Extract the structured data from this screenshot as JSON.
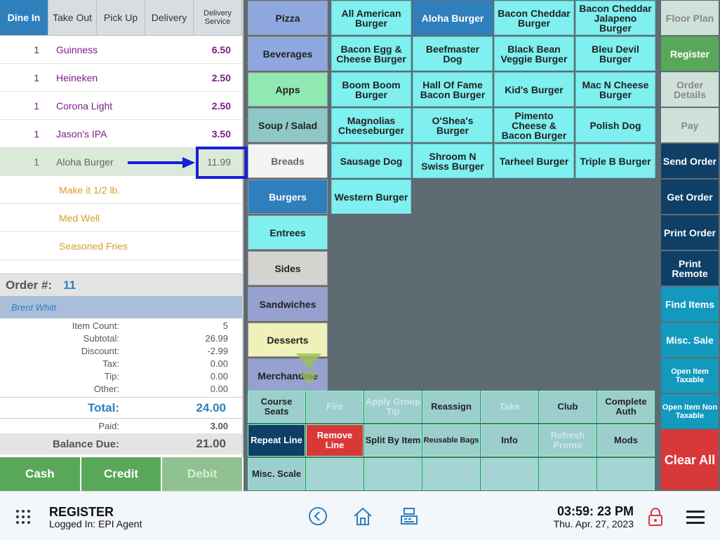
{
  "order_tabs": [
    {
      "label": "Dine In",
      "active": true
    },
    {
      "label": "Take Out"
    },
    {
      "label": "Pick Up"
    },
    {
      "label": "Delivery"
    },
    {
      "label": "Delivery Service"
    }
  ],
  "items": [
    {
      "qty": "1",
      "name": "Guinness",
      "price": "6.50"
    },
    {
      "qty": "1",
      "name": "Heineken",
      "price": "2.50"
    },
    {
      "qty": "1",
      "name": "Corona Light",
      "price": "2.50"
    },
    {
      "qty": "1",
      "name": "Jason's IPA",
      "price": "3.50"
    },
    {
      "qty": "1",
      "name": "Aloha Burger",
      "price": "11.99",
      "selected": true
    },
    {
      "name": "Make it 1/2 lb.",
      "modifier": true
    },
    {
      "name": "Med Well",
      "modifier": true
    },
    {
      "name": "Seasoned Fries",
      "modifier": true
    }
  ],
  "order": {
    "label": "Order #:",
    "number": "11",
    "customer": "Brent Whitt"
  },
  "totals": [
    {
      "k": "Item Count:",
      "v": "5"
    },
    {
      "k": "Subtotal:",
      "v": "26.99"
    },
    {
      "k": "Discount:",
      "v": "-2.99"
    },
    {
      "k": "Tax:",
      "v": "0.00"
    },
    {
      "k": "Tip:",
      "v": "0.00"
    },
    {
      "k": "Other:",
      "v": "0.00"
    }
  ],
  "total": {
    "k": "Total:",
    "v": "24.00"
  },
  "paid": {
    "k": "Paid:",
    "v": "3.00"
  },
  "balance": {
    "k": "Balance Due:",
    "v": "21.00"
  },
  "pay_buttons": [
    "Cash",
    "Credit",
    "Debit"
  ],
  "categories": [
    "Pizza",
    "Beverages",
    "Apps",
    "Soup / Salad",
    "Breads",
    "Burgers",
    "Entrees",
    "Sides",
    "Sandwiches",
    "Desserts",
    "Merchandise"
  ],
  "menu_items": [
    "All American Burger",
    "Aloha Burger",
    "Bacon Cheddar Burger",
    "Bacon Cheddar Jalapeno Burger",
    "Bacon Egg & Cheese Burger",
    "Beefmaster Dog",
    "Black Bean Veggie Burger",
    "Bleu Devil Burger",
    "Boom Boom Burger",
    "Hall Of Fame Bacon Burger",
    "Kid's Burger",
    "Mac N Cheese Burger",
    "Magnolias Cheeseburger",
    "O'Shea's Burger",
    "Pimento Cheese & Bacon Burger",
    "Polish Dog",
    "Sausage Dog",
    "Shroom N Swiss Burger",
    "Tarheel Burger",
    "Triple B Burger",
    "Western Burger"
  ],
  "actions": [
    "Course Seats",
    "Fire",
    "Apply Group Tip",
    "Reassign",
    "Take",
    "Club",
    "Complete Auth",
    "Repeat Line",
    "Remove Line",
    "Split By Item",
    "Reusable Bags",
    "Info",
    "Refresh Promo",
    "Mods",
    "Misc. Scale"
  ],
  "right_buttons": [
    "Floor Plan",
    "Register",
    "Order Details",
    "Pay",
    "Send Order",
    "Get Order",
    "Print Order",
    "Print Remote",
    "Find Items",
    "Misc. Sale",
    "Open Item Taxable",
    "Open Item Non Taxable",
    "Clear All"
  ],
  "footer": {
    "title": "REGISTER",
    "logged_in": "Logged In:  EPI Agent",
    "time": "03:59: 23 PM",
    "date": "Thu. Apr. 27, 2023"
  },
  "colors": {
    "accent": "#2f7fbd",
    "highlight": "#1520d8",
    "menu_item": "#7fefef"
  }
}
